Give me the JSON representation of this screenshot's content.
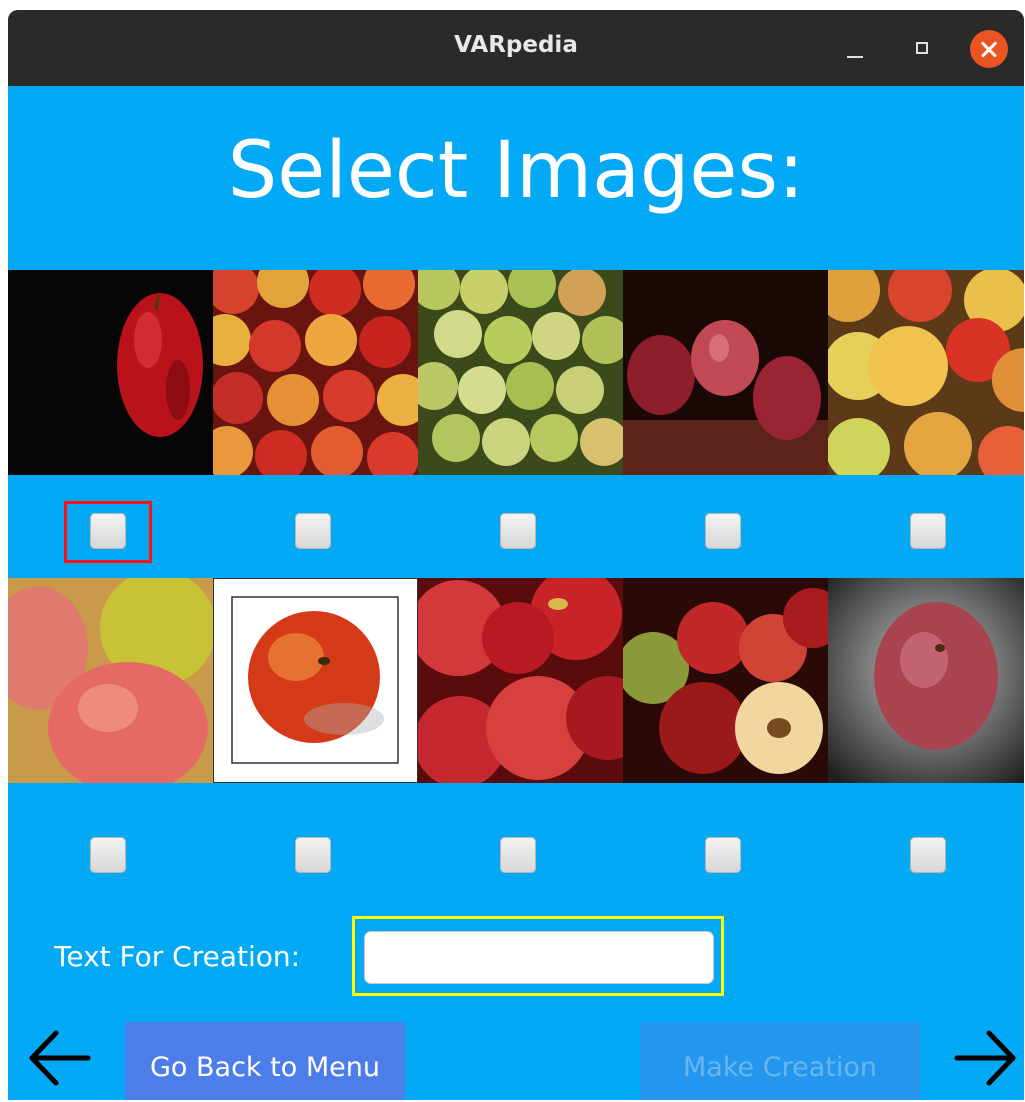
{
  "window": {
    "title": "VARpedia",
    "controls": [
      "minimize-icon",
      "maximize-icon",
      "close-icon"
    ]
  },
  "heading": "Select Images:",
  "images": [
    {
      "row": 1,
      "col": 1,
      "selected": false
    },
    {
      "row": 1,
      "col": 2,
      "selected": false
    },
    {
      "row": 1,
      "col": 3,
      "selected": false
    },
    {
      "row": 1,
      "col": 4,
      "selected": false
    },
    {
      "row": 1,
      "col": 5,
      "selected": false
    },
    {
      "row": 2,
      "col": 1,
      "selected": false
    },
    {
      "row": 2,
      "col": 2,
      "selected": false
    },
    {
      "row": 2,
      "col": 3,
      "selected": false
    },
    {
      "row": 2,
      "col": 4,
      "selected": false
    },
    {
      "row": 2,
      "col": 5,
      "selected": false
    }
  ],
  "text_for_creation": {
    "label": "Text For Creation:",
    "value": ""
  },
  "buttons": {
    "back_label": "Go Back to Menu",
    "make_label": "Make Creation",
    "make_enabled": false
  },
  "icons": {
    "left": "arrow-left-icon",
    "right": "arrow-right-icon"
  },
  "colors": {
    "background": "#03a9f4",
    "titlebar": "#2a2a2a",
    "close_button": "#e95420",
    "back_button": "#4d7de8",
    "make_button_disabled": "#2496ee",
    "focus_red": "#ff1111",
    "focus_yellow": "#ffff00"
  }
}
